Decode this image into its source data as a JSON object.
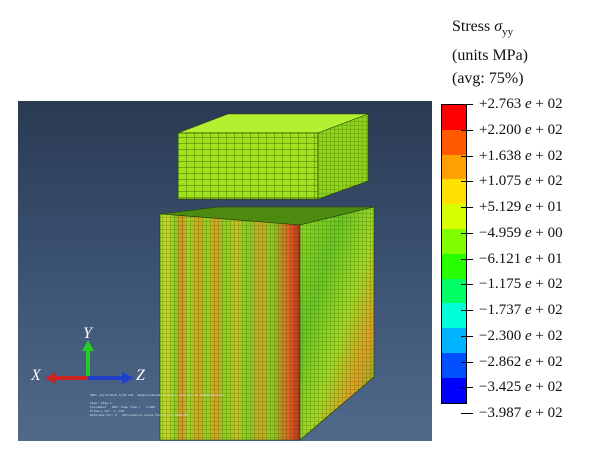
{
  "legend": {
    "title_line1_prefix": "Stress ",
    "title_symbol": "σ",
    "title_subscript": "yy",
    "title_line2": "(units MPa)",
    "title_line3": "(avg: 75%)",
    "ticks": [
      {
        "mantissa": "+2.763",
        "exponent": "+ 02"
      },
      {
        "mantissa": "+2.200",
        "exponent": "+ 02"
      },
      {
        "mantissa": "+1.638",
        "exponent": "+ 02"
      },
      {
        "mantissa": "+1.075",
        "exponent": "+ 02"
      },
      {
        "mantissa": "+5.129",
        "exponent": "+ 01"
      },
      {
        "mantissa": "−4.959",
        "exponent": "+ 00"
      },
      {
        "mantissa": "−6.121",
        "exponent": "+ 01"
      },
      {
        "mantissa": "−1.175",
        "exponent": "+ 02"
      },
      {
        "mantissa": "−1.737",
        "exponent": "+ 02"
      },
      {
        "mantissa": "−2.300",
        "exponent": "+ 02"
      },
      {
        "mantissa": "−2.862",
        "exponent": "+ 02"
      },
      {
        "mantissa": "−3.425",
        "exponent": "+ 02"
      },
      {
        "mantissa": "−3.987",
        "exponent": "+ 02"
      }
    ],
    "colors": [
      "#ff0000",
      "#ff5a00",
      "#ffa000",
      "#ffe000",
      "#d8ff00",
      "#80ff00",
      "#28ff00",
      "#00ff64",
      "#00ffd8",
      "#00b4ff",
      "#0050ff",
      "#0000ff"
    ]
  },
  "triad": {
    "y_label": "Y",
    "x_label": "X",
    "z_label": "Z"
  },
  "viewport": {
    "status_text": "ODB: dsjvhrkmc8_0_M2.odb  Abaqus/Standard 6.13-1  Wed Jan 01 00:00:00 2014\n\nStep: Step-1\nIncrement   100: Step Time =   1.000\nPrimary Var: S, S22\nDeformed Var: U   Deformation Scale Factor: +1.000e+00"
  }
}
